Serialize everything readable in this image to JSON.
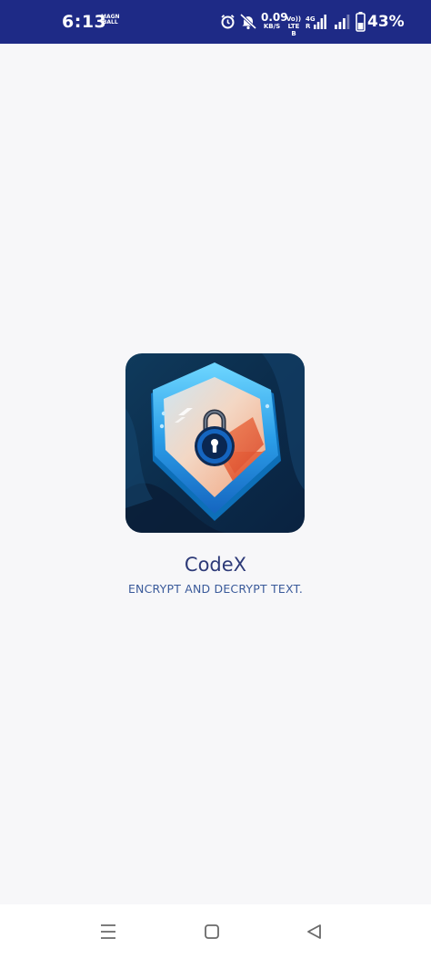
{
  "status_bar": {
    "time": "6:13",
    "mini_label_line1": "MAGN",
    "mini_label_line2": "BALL",
    "net_speed_value": "0.09",
    "net_speed_unit": "KB/S",
    "volte_line1": "Vo))",
    "volte_line2": "LTE B",
    "net_type_line1": "4G",
    "net_type_line2": "R",
    "battery_percent": "43%",
    "icons": [
      "alarm-icon",
      "do-not-disturb-icon",
      "signal-icon",
      "signal-icon",
      "battery-icon"
    ],
    "background_color": "#1e2a86"
  },
  "splash": {
    "logo_icon": "padlock-shield-icon",
    "app_name": "CodeX",
    "tagline": "ENCRYPT AND DECRYPT TEXT.",
    "name_color": "#2d3a78",
    "tagline_color": "#3a5a9a"
  },
  "nav_bar": {
    "buttons": [
      "menu-icon",
      "home-icon",
      "back-icon"
    ]
  }
}
